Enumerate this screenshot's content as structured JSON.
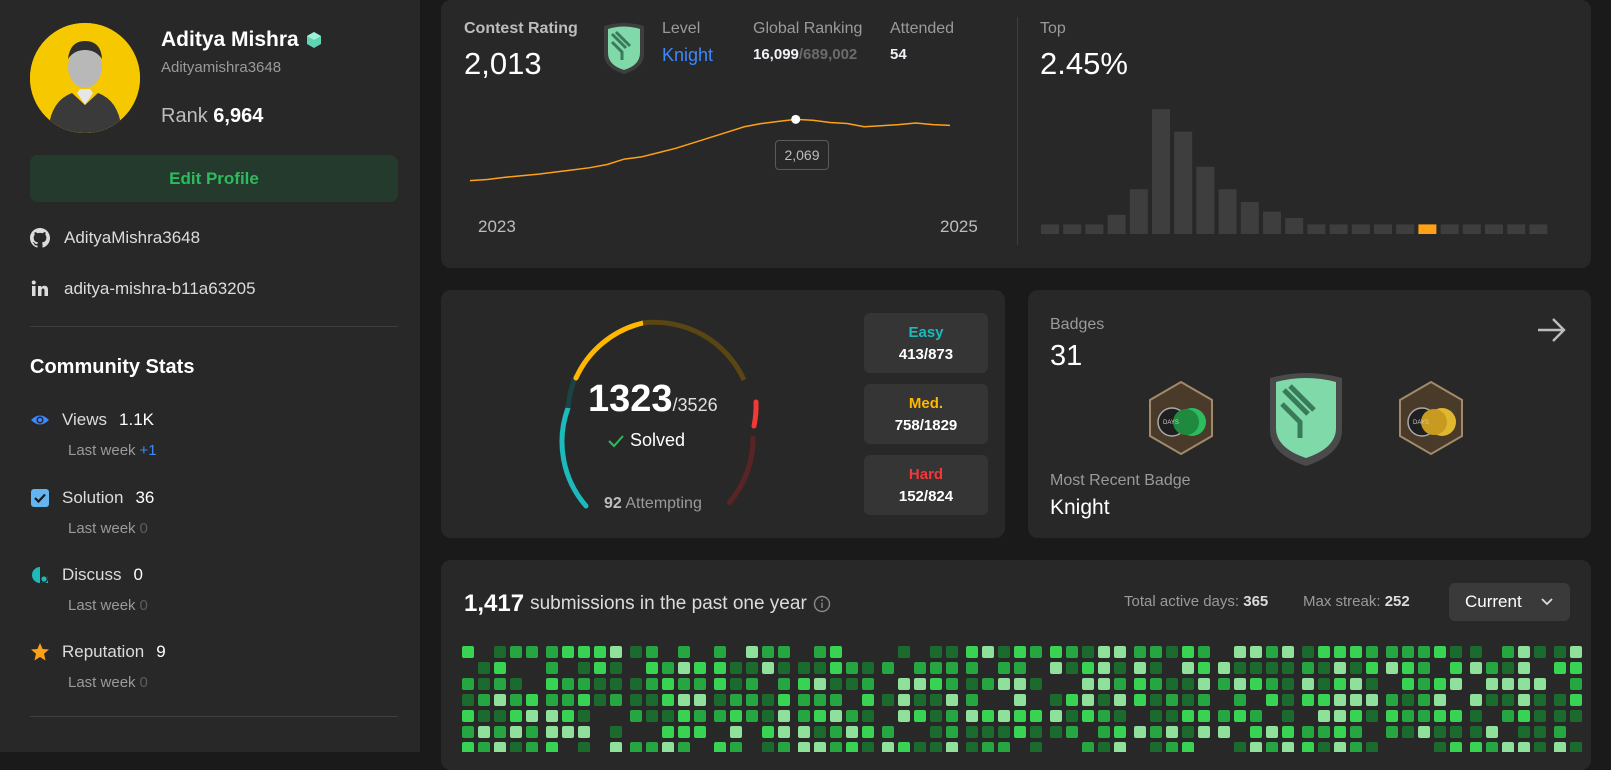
{
  "profile": {
    "name": "Aditya Mishra",
    "username": "Adityamishra3648",
    "rank_label": "Rank",
    "rank_value": "6,964",
    "edit_label": "Edit Profile",
    "github": "AdityaMishra3648",
    "linkedin": "aditya-mishra-b11a63205"
  },
  "community": {
    "title": "Community Stats",
    "stats": [
      {
        "label": "Views",
        "value": "1.1K",
        "last_week_label": "Last week",
        "delta": "+1"
      },
      {
        "label": "Solution",
        "value": "36",
        "last_week_label": "Last week",
        "delta": "0"
      },
      {
        "label": "Discuss",
        "value": "0",
        "last_week_label": "Last week",
        "delta": "0"
      },
      {
        "label": "Reputation",
        "value": "9",
        "last_week_label": "Last week",
        "delta": "0"
      }
    ]
  },
  "contest": {
    "rating_label": "Contest Rating",
    "rating": "2,013",
    "level_label": "Level",
    "level": "Knight",
    "ranking_label": "Global Ranking",
    "ranking": "16,099",
    "ranking_total": "/689,002",
    "attended_label": "Attended",
    "attended": "54",
    "tooltip": "2,069",
    "year_start": "2023",
    "year_end": "2025",
    "top_label": "Top",
    "top_value": "2.45%"
  },
  "chart_data": [
    {
      "type": "line",
      "title": "",
      "x": [
        "2023",
        "2025"
      ],
      "series": [
        {
          "values": [
            1500,
            1510,
            1530,
            1545,
            1560,
            1580,
            1600,
            1620,
            1650,
            1700,
            1720,
            1760,
            1800,
            1850,
            1900,
            1950,
            2000,
            2030,
            2050,
            2069,
            2060,
            2040,
            2030,
            2000,
            2010,
            2020,
            2035,
            2020,
            2013
          ]
        }
      ]
    },
    {
      "type": "bar",
      "title": "",
      "values": [
        3,
        3,
        3,
        6,
        14,
        39,
        32,
        21,
        14,
        10,
        7,
        5,
        3,
        3,
        3,
        3,
        3,
        3,
        3,
        3,
        3,
        3,
        3
      ],
      "highlight_index": 17,
      "colors": {
        "bar": "#3e3e3e",
        "highlight": "#ffa116"
      }
    }
  ],
  "solved": {
    "count": "1323",
    "total": "/3526",
    "label": "Solved",
    "attempting_count": "92",
    "attempting_label": "Attempting",
    "easy_label": "Easy",
    "easy": "413/873",
    "med_label": "Med.",
    "med": "758/1829",
    "hard_label": "Hard",
    "hard": "152/824"
  },
  "badges": {
    "label": "Badges",
    "count": "31",
    "recent_label": "Most Recent Badge",
    "recent": "Knight",
    "badge_labels": [
      "DAYS",
      "DAYS"
    ]
  },
  "submissions": {
    "count": "1,417",
    "text": "submissions in the past one year",
    "active_label": "Total active days:",
    "active": "365",
    "streak_label": "Max streak:",
    "streak": "252",
    "select": "Current"
  },
  "colors": {
    "orange": "#ffa116",
    "green": "#2cbb5d",
    "easy": "#1cbaba",
    "med": "#ffb700",
    "hard": "#f63737",
    "link": "#3b88ff"
  }
}
